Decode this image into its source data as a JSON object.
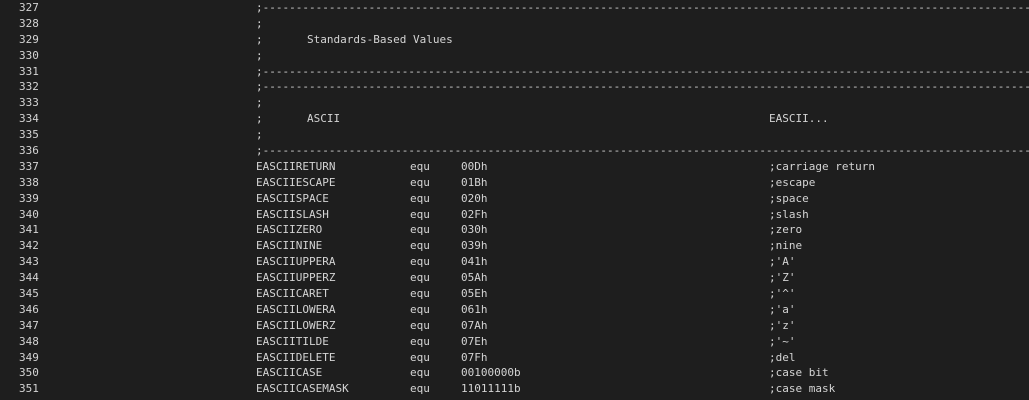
{
  "code_lines": [
    {
      "num": "327",
      "kind": "separator",
      "text": ";------------------------------------------------------------------------------------------------------------------------------------------------------"
    },
    {
      "num": "328",
      "kind": "comment",
      "prefix": ";",
      "text": "",
      "right": ""
    },
    {
      "num": "329",
      "kind": "comment",
      "prefix": ";",
      "text": "Standards-Based Values",
      "right": ""
    },
    {
      "num": "330",
      "kind": "comment",
      "prefix": ";",
      "text": "",
      "right": ""
    },
    {
      "num": "331",
      "kind": "separator",
      "text": ";------------------------------------------------------------------------------------------------------------------------------------------------------"
    },
    {
      "num": "332",
      "kind": "separator",
      "text": ";------------------------------------------------------------------------------------------------------------------------------------------------------"
    },
    {
      "num": "333",
      "kind": "comment",
      "prefix": ";",
      "text": "",
      "right": ""
    },
    {
      "num": "334",
      "kind": "comment",
      "prefix": ";",
      "text": "ASCII",
      "right": "EASCII..."
    },
    {
      "num": "335",
      "kind": "comment",
      "prefix": ";",
      "text": "",
      "right": ""
    },
    {
      "num": "336",
      "kind": "separator",
      "text": ";------------------------------------------------------------------------------------------------------------------------------------------------------"
    },
    {
      "num": "337",
      "kind": "equate",
      "label": "EASCIIRETURN",
      "op": "equ",
      "value": "00Dh",
      "comment": ";carriage return"
    },
    {
      "num": "338",
      "kind": "equate",
      "label": "EASCIIESCAPE",
      "op": "equ",
      "value": "01Bh",
      "comment": ";escape"
    },
    {
      "num": "339",
      "kind": "equate",
      "label": "EASCIISPACE",
      "op": "equ",
      "value": "020h",
      "comment": ";space"
    },
    {
      "num": "340",
      "kind": "equate",
      "label": "EASCIISLASH",
      "op": "equ",
      "value": "02Fh",
      "comment": ";slash"
    },
    {
      "num": "341",
      "kind": "equate",
      "label": "EASCIIZERO",
      "op": "equ",
      "value": "030h",
      "comment": ";zero"
    },
    {
      "num": "342",
      "kind": "equate",
      "label": "EASCIININE",
      "op": "equ",
      "value": "039h",
      "comment": ";nine"
    },
    {
      "num": "343",
      "kind": "equate",
      "label": "EASCIIUPPERA",
      "op": "equ",
      "value": "041h",
      "comment": ";'A'"
    },
    {
      "num": "344",
      "kind": "equate",
      "label": "EASCIIUPPERZ",
      "op": "equ",
      "value": "05Ah",
      "comment": ";'Z'"
    },
    {
      "num": "345",
      "kind": "equate",
      "label": "EASCIICARET",
      "op": "equ",
      "value": "05Eh",
      "comment": ";'^'"
    },
    {
      "num": "346",
      "kind": "equate",
      "label": "EASCIILOWERA",
      "op": "equ",
      "value": "061h",
      "comment": ";'a'"
    },
    {
      "num": "347",
      "kind": "equate",
      "label": "EASCIILOWERZ",
      "op": "equ",
      "value": "07Ah",
      "comment": ";'z'"
    },
    {
      "num": "348",
      "kind": "equate",
      "label": "EASCIITILDE",
      "op": "equ",
      "value": "07Eh",
      "comment": ";'~'"
    },
    {
      "num": "349",
      "kind": "equate",
      "label": "EASCIIDELETE",
      "op": "equ",
      "value": "07Fh",
      "comment": ";del"
    },
    {
      "num": "350",
      "kind": "equate",
      "label": "EASCIICASE",
      "op": "equ",
      "value": "00100000b",
      "comment": ";case bit"
    },
    {
      "num": "351",
      "kind": "equate",
      "label": "EASCIICASEMASK",
      "op": "equ",
      "value": "11011111b",
      "comment": ";case mask"
    }
  ]
}
